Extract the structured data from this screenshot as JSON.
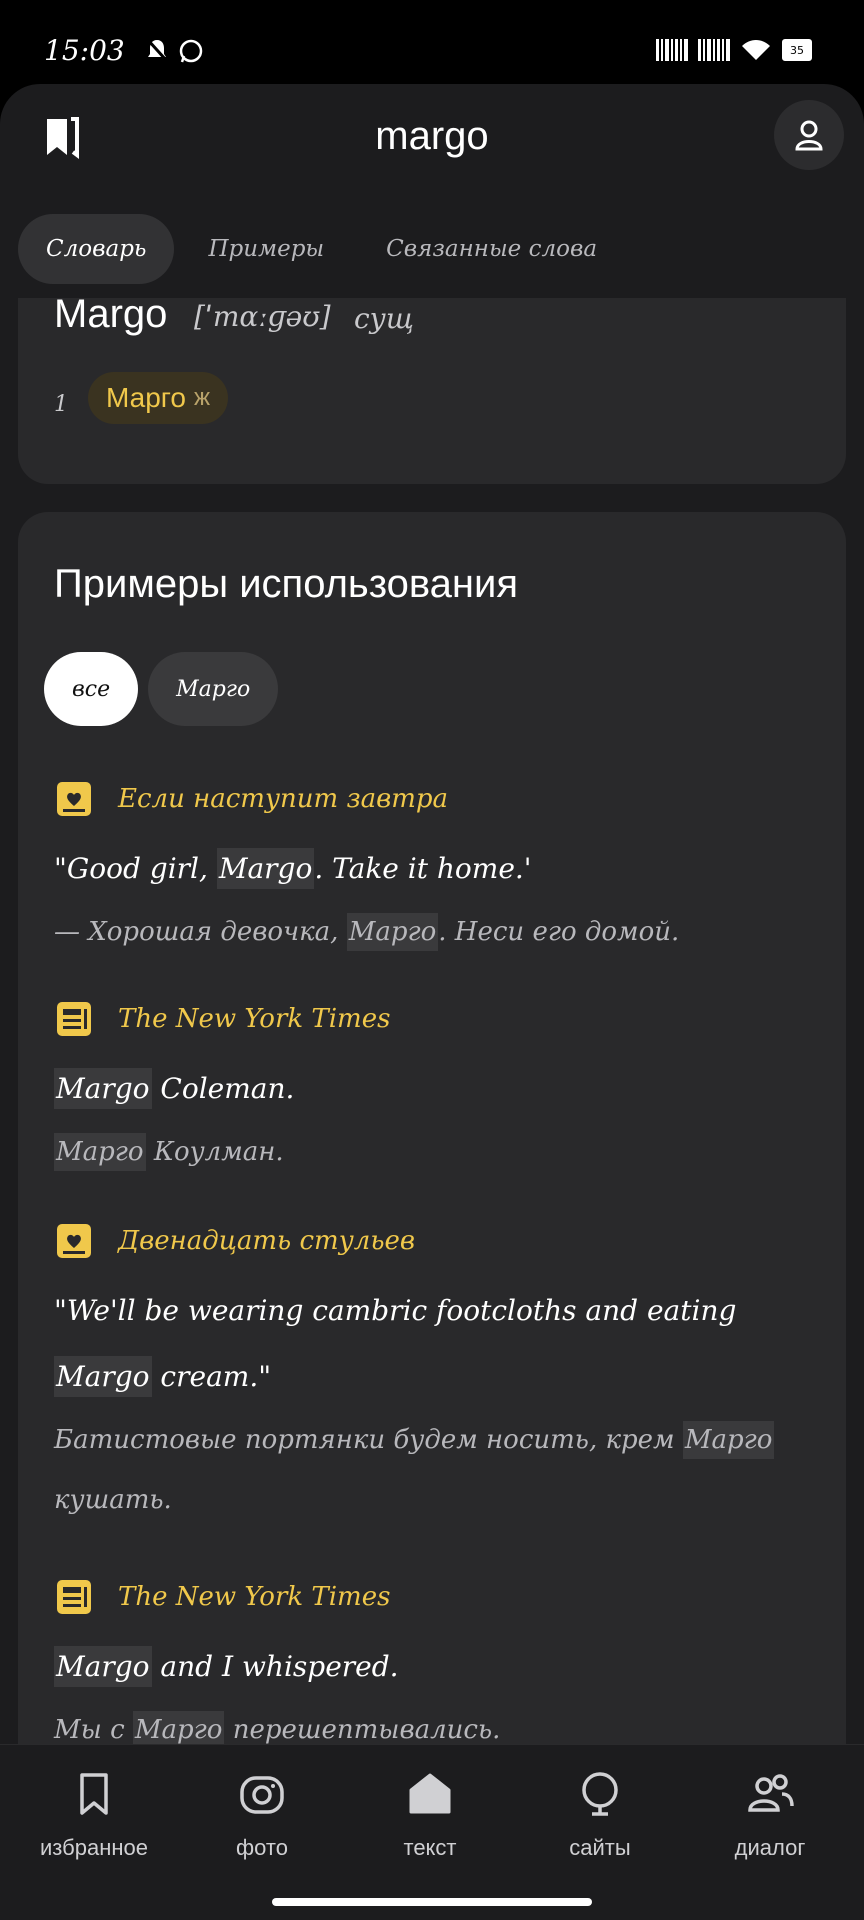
{
  "status_bar": {
    "time": "15:03",
    "battery": "35"
  },
  "header": {
    "title": "margo"
  },
  "tabs": [
    {
      "label": "Словарь",
      "active": true
    },
    {
      "label": "Примеры",
      "active": false
    },
    {
      "label": "Связанные слова",
      "active": false
    }
  ],
  "entry": {
    "word": "Margo",
    "transcription": "[ˈmɑːɡəʊ]",
    "part_of_speech": "сущ",
    "sense_number": "1",
    "translation": "Марго",
    "gender": "ж"
  },
  "examples_section": {
    "heading": "Примеры использования",
    "filters": [
      {
        "label": "все",
        "active": true
      },
      {
        "label": "Марго",
        "active": false
      }
    ],
    "items": [
      {
        "source_icon": "book-icon",
        "source": "Если наступит завтра",
        "en_before": "\"Good girl, ",
        "en_hl": "Margo",
        "en_after": ". Take it home.'",
        "ru_before": "— Хорошая девочка, ",
        "ru_hl": "Марго",
        "ru_after": ". Неси его домой."
      },
      {
        "source_icon": "newspaper-icon",
        "source": "The New York Times",
        "en_before": "",
        "en_hl": "Margo",
        "en_after": " Coleman.",
        "ru_before": "",
        "ru_hl": "Марго",
        "ru_after": " Коулман."
      },
      {
        "source_icon": "book-icon",
        "source": "Двенадцать стульев",
        "en_before": "\"We'll be wearing cambric footcloths and eating ",
        "en_hl": "Margo",
        "en_after": " cream.\"",
        "ru_before": "Батистовые портянки будем носить, крем ",
        "ru_hl": "Марго",
        "ru_after": " кушать."
      },
      {
        "source_icon": "newspaper-icon",
        "source": "The New York Times",
        "en_before": "",
        "en_hl": "Margo",
        "en_after": " and I whispered.",
        "ru_before": "Мы с ",
        "ru_hl": "Марго",
        "ru_after": " перешептывались."
      }
    ]
  },
  "bottom_nav": [
    {
      "icon": "bookmark-icon",
      "label": "избранное"
    },
    {
      "icon": "camera-icon",
      "label": "фото"
    },
    {
      "icon": "home-icon",
      "label": "текст"
    },
    {
      "icon": "globe-icon",
      "label": "сайты"
    },
    {
      "icon": "people-icon",
      "label": "диалог"
    }
  ],
  "colors": {
    "accent": "#f0c84b",
    "background": "#1c1c1e",
    "card": "#29292b"
  }
}
